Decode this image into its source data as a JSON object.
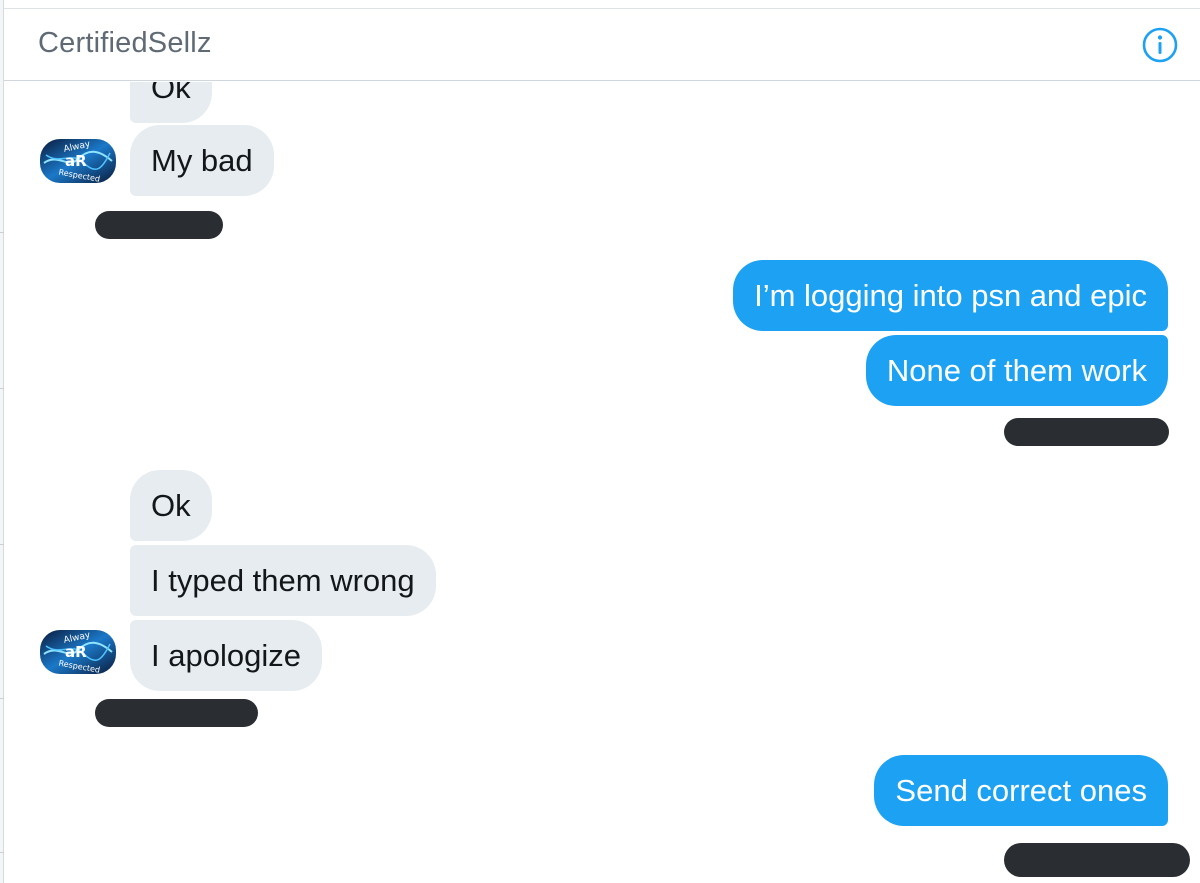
{
  "header": {
    "title": "CertifiedSellz",
    "info_icon": "info-icon"
  },
  "avatar": {
    "text_top": "Alway",
    "text_mid": "aR",
    "text_bottom": "Respected"
  },
  "messages": [
    {
      "from": "them",
      "text": "Ok"
    },
    {
      "from": "them",
      "text": "My bad"
    },
    {
      "from": "me",
      "text": "I’m logging into psn and epic"
    },
    {
      "from": "me",
      "text": "None of them work"
    },
    {
      "from": "them",
      "text": "Ok"
    },
    {
      "from": "them",
      "text": "I typed them wrong"
    },
    {
      "from": "them",
      "text": "I apologize"
    },
    {
      "from": "me",
      "text": "Send correct ones"
    }
  ],
  "colors": {
    "sent_bubble": "#1da1f2",
    "received_bubble": "#e6ecf0",
    "redaction": "#2a2e33"
  }
}
